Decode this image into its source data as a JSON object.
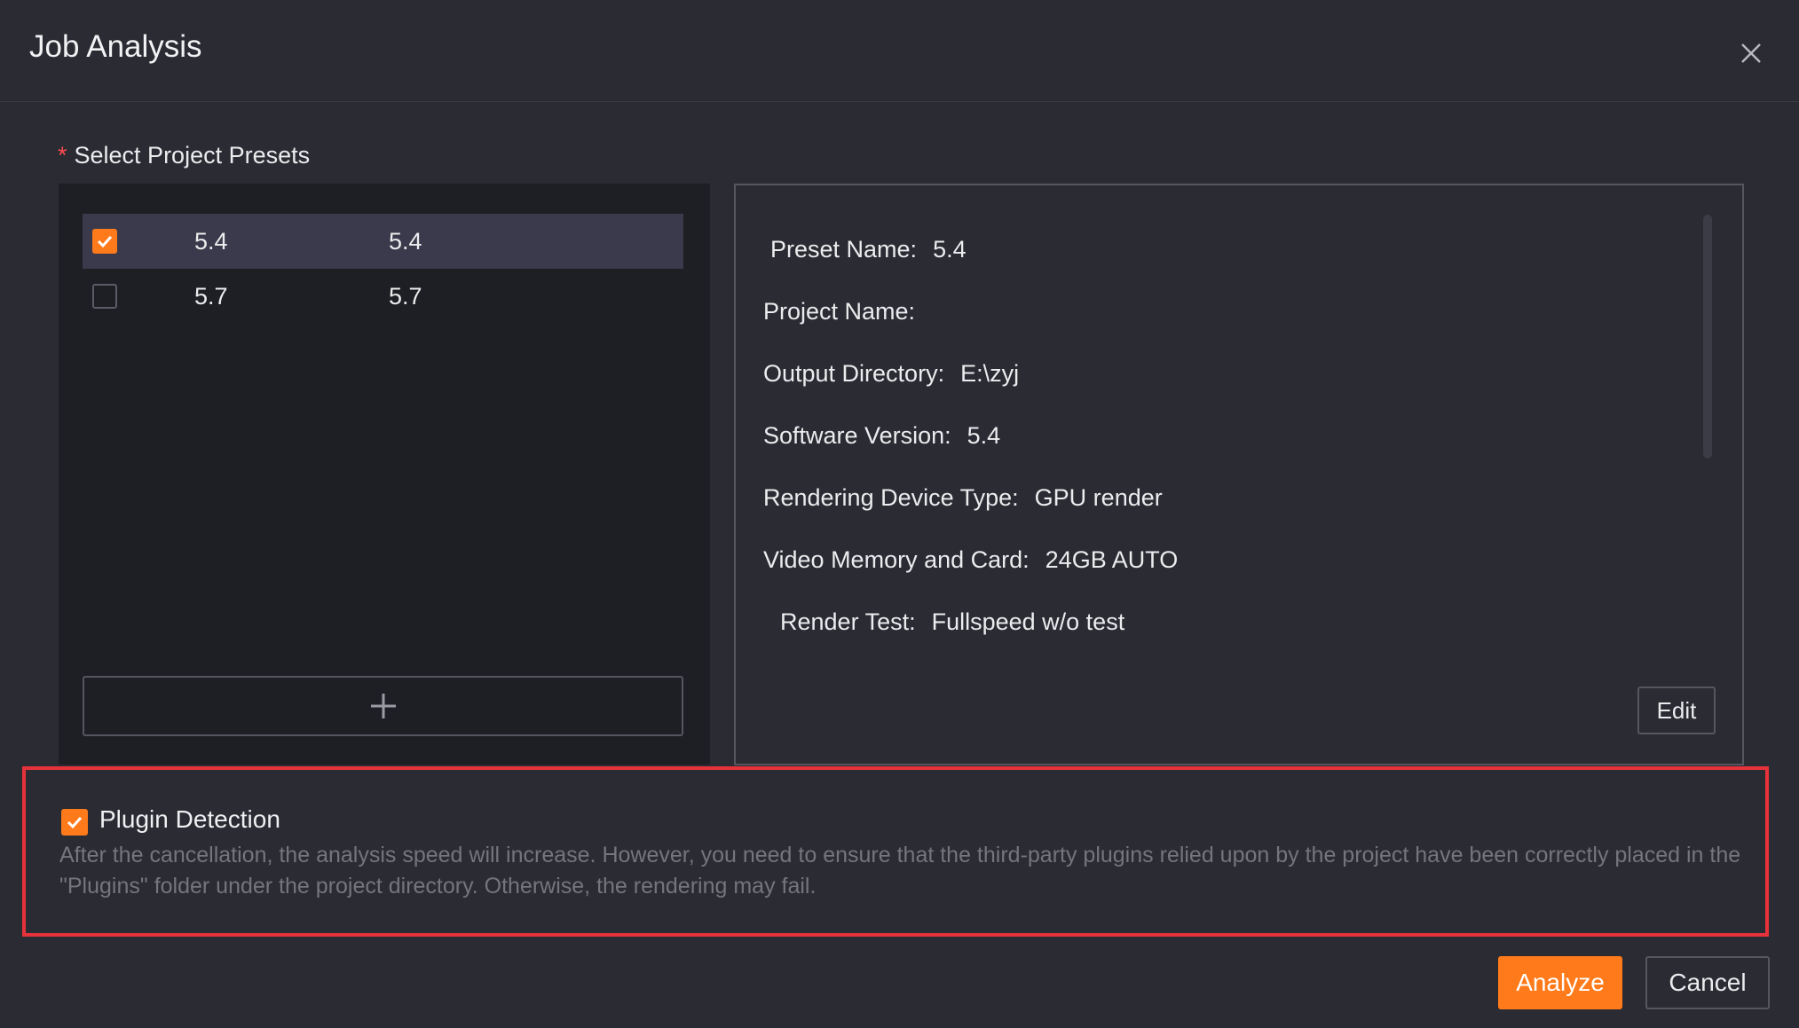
{
  "dialog": {
    "title": "Job Analysis",
    "close_icon": "close-icon"
  },
  "presets": {
    "label_required_mark": "*",
    "label": "Select Project Presets",
    "items": [
      {
        "name": "5.4",
        "version": "5.4",
        "checked": true
      },
      {
        "name": "5.7",
        "version": "5.7",
        "checked": false
      }
    ],
    "add_icon": "plus-icon"
  },
  "details": {
    "preset_name_label": "Preset Name:",
    "preset_name_value": "5.4",
    "project_name_label": "Project Name:",
    "project_name_value": "",
    "output_directory_label": "Output Directory:",
    "output_directory_value": "E:\\zyj",
    "software_version_label": "Software Version:",
    "software_version_value": "5.4",
    "device_type_label": "Rendering Device Type:",
    "device_type_value": "GPU render",
    "video_memory_label": "Video Memory and Card:",
    "video_memory_value": "24GB AUTO",
    "render_test_label": "Render Test:",
    "render_test_value": "Fullspeed w/o test",
    "edit_label": "Edit"
  },
  "plugin": {
    "checked": true,
    "label": "Plugin Detection",
    "description": "After the cancellation, the analysis speed will increase. However, you need to ensure that the third-party plugins relied upon by the project have been correctly placed in the \"Plugins\" folder under the project directory. Otherwise, the rendering may fail."
  },
  "footer": {
    "analyze_label": "Analyze",
    "cancel_label": "Cancel"
  },
  "colors": {
    "accent": "#ff7a1a",
    "highlight_border": "#e8323a",
    "background": "#2a2b33",
    "list_background": "#1e1f24",
    "selected_row": "#3a3a4c"
  }
}
